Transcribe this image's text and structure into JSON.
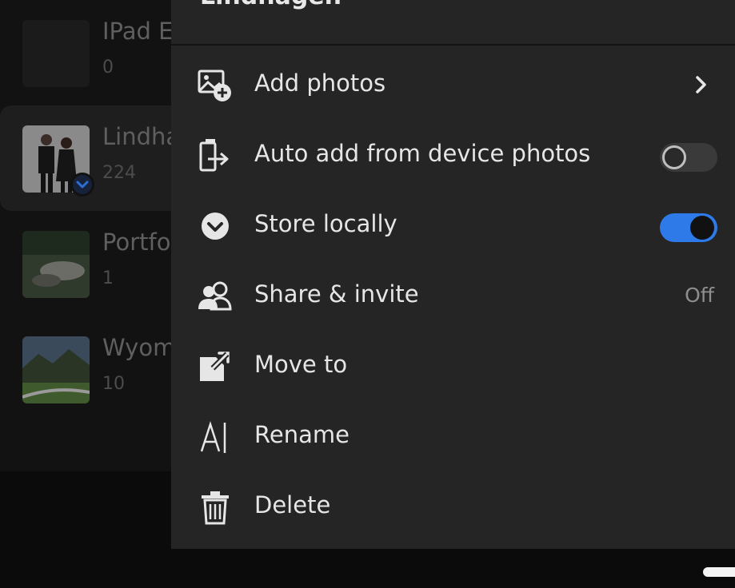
{
  "albums": [
    {
      "name": "IPad Ea",
      "count": "0"
    },
    {
      "name": "Lindha",
      "count": "224"
    },
    {
      "name": "Portfo",
      "count": "1"
    },
    {
      "name": "Wyom",
      "count": "10"
    }
  ],
  "menu": {
    "title": "Lindhagen",
    "items": [
      {
        "label": "Add photos",
        "icon": "add-photo-icon",
        "trailing": "chevron-right-icon"
      },
      {
        "label": "Auto add from device photos",
        "icon": "auto-add-icon",
        "toggle": "off"
      },
      {
        "label": "Store locally",
        "icon": "store-locally-icon",
        "toggle": "on"
      },
      {
        "label": "Share & invite",
        "icon": "share-people-icon",
        "value": "Off"
      },
      {
        "label": "Move to",
        "icon": "move-to-icon"
      },
      {
        "label": "Rename",
        "icon": "rename-icon"
      },
      {
        "label": "Delete",
        "icon": "trash-icon"
      }
    ]
  },
  "colors": {
    "accent": "#2d7ae8",
    "menu_bg": "#252525",
    "page_bg": "#0e0e0e"
  }
}
